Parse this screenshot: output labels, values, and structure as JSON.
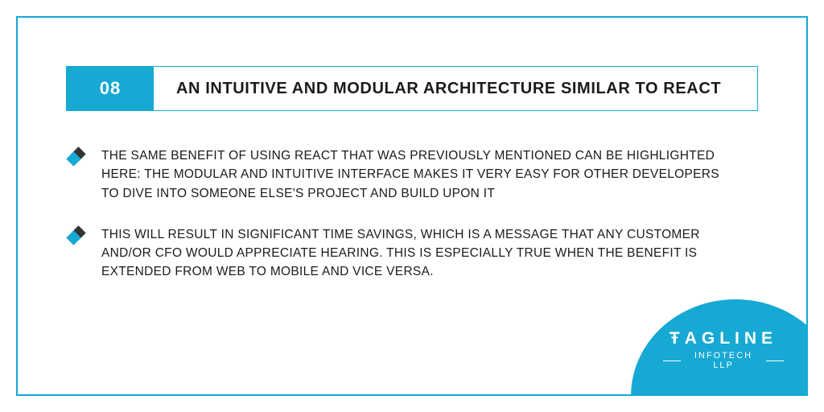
{
  "slide": {
    "number": "08",
    "title": "AN INTUITIVE AND MODULAR ARCHITECTURE SIMILAR TO REACT"
  },
  "bullets": [
    "THE SAME BENEFIT OF USING REACT THAT WAS PREVIOUSLY MENTIONED CAN BE HIGHLIGHTED HERE: THE MODULAR AND INTUITIVE INTERFACE MAKES IT VERY EASY FOR OTHER DEVELOPERS TO DIVE INTO SOMEONE ELSE'S PROJECT AND BUILD UPON IT",
    "THIS WILL RESULT IN SIGNIFICANT TIME SAVINGS, WHICH IS A MESSAGE THAT ANY CUSTOMER AND/OR CFO WOULD APPRECIATE HEARING. THIS IS ESPECIALLY TRUE WHEN THE BENEFIT IS EXTENDED FROM WEB TO MOBILE AND VICE VERSA."
  ],
  "brand": {
    "name": "ŦAGLINE",
    "sub": "INFOTECH LLP"
  },
  "colors": {
    "accent": "#16a9d4",
    "text": "#1b1b1b"
  }
}
